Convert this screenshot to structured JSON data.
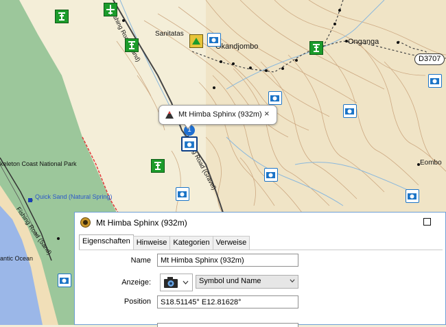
{
  "map": {
    "labels": {
      "sanitatas": "Sanitatas",
      "okandjombo": "Okandjombo",
      "onganga": "Onganga",
      "eombo": "Eombo",
      "skeleton_coast": "keleton Coast National Park",
      "quick_sand": "Quick Sand (Natural Spring)",
      "ocean": "antic Ocean",
      "road_top": "Fishing Road (Sand)",
      "road_mid": "Fishing Road (Gravel)",
      "road_coast": "Fishing Road (Sand)"
    },
    "road_shield": "D3707",
    "marker_number": "1",
    "bubble": {
      "title": "Mt Himba Sphinx (932m)",
      "close": "×"
    }
  },
  "dialog": {
    "title": "Mt Himba Sphinx (932m)",
    "tabs": [
      {
        "label": "Eigenschaften",
        "active": true
      },
      {
        "label": "Hinweise",
        "active": false
      },
      {
        "label": "Kategorien",
        "active": false
      },
      {
        "label": "Verweise",
        "active": false
      }
    ],
    "fields": {
      "name_label": "Name",
      "name_value": "Mt Himba Sphinx (932m)",
      "display_label": "Anzeige:",
      "display_value": "Symbol und Name",
      "position_label": "Position",
      "position_value": "S18.51145° E12.81628°"
    },
    "icons": {
      "dialog_icon": "waypoint-icon",
      "display_symbol": "camera-icon"
    }
  },
  "colors": {
    "land": "#f4eed8",
    "park": "#9cc79b",
    "sea": "#9bb7e8",
    "sand": "#f1dfb8",
    "contour": "#c9a27a",
    "river": "#8ab8dd",
    "road": "#444444",
    "poi_green": "#1c9b2b",
    "camera": "#1b74c7",
    "border": "#e23b3b"
  }
}
